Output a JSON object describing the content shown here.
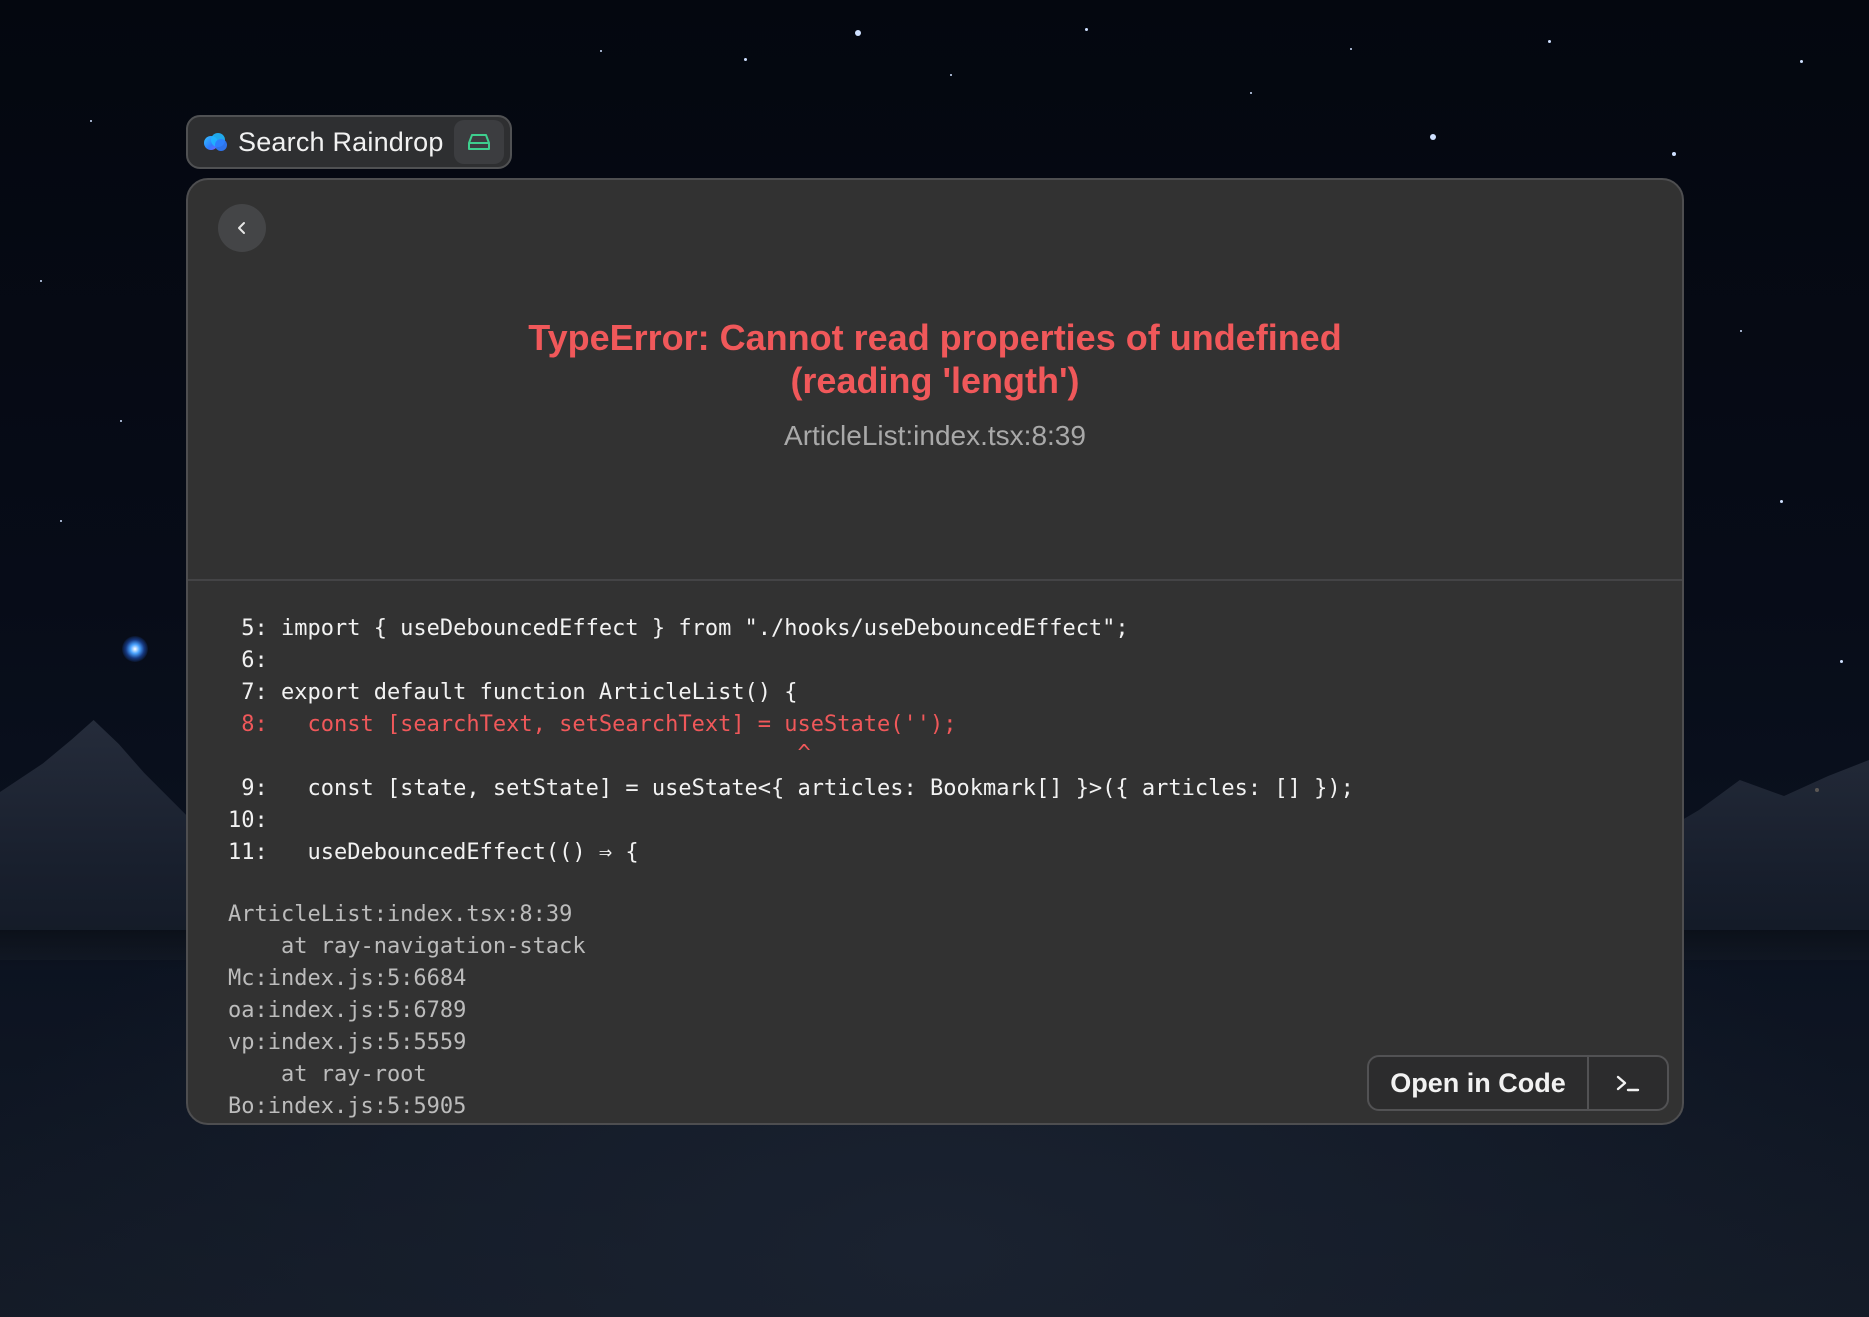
{
  "search_bar": {
    "title": "Search Raindrop",
    "icon": "cloud-icon",
    "action_icon": "drive-icon"
  },
  "error": {
    "title": "TypeError: Cannot read properties of undefined\n(reading 'length')",
    "location": "ArticleList:index.tsx:8:39"
  },
  "code": {
    "lines": [
      " 5: import { useDebouncedEffect } from \"./hooks/useDebouncedEffect\";",
      " 6:",
      " 7: export default function ArticleList() {",
      " 8:   const [searchText, setSearchText] = useState('');",
      "                                           ^",
      " 9:   const [state, setState] = useState<{ articles: Bookmark[] }>({ articles: [] });",
      "10:",
      "11:   useDebouncedEffect(() ⇒ {"
    ]
  },
  "stack": {
    "lines": [
      "ArticleList:index.tsx:8:39",
      "    at ray-navigation-stack",
      "Mc:index.js:5:6684",
      "oa:index.js:5:6789",
      "vp:index.js:5:5559",
      "    at ray-root",
      "Bo:index.js:5:5905"
    ]
  },
  "actions": {
    "open_in_code": "Open in Code",
    "terminal_icon": "terminal-icon"
  },
  "colors": {
    "error": "#f0585a",
    "window_bg": "#323232",
    "accent_green": "#3ecf8e"
  }
}
